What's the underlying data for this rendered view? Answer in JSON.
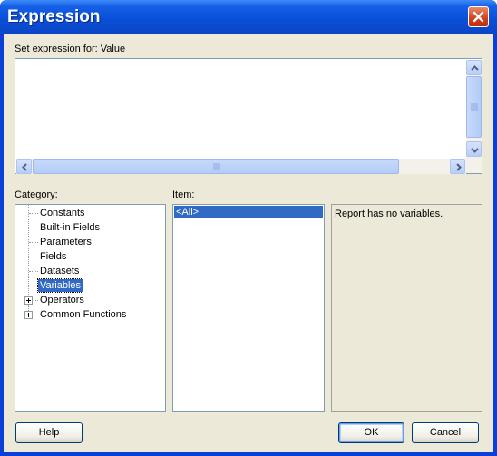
{
  "window": {
    "title": "Expression"
  },
  "expression": {
    "label": "Set expression for: Value",
    "value": ""
  },
  "category": {
    "label": "Category:",
    "items": [
      {
        "label": "Constants",
        "expandable": false,
        "selected": false
      },
      {
        "label": "Built-in Fields",
        "expandable": false,
        "selected": false
      },
      {
        "label": "Parameters",
        "expandable": false,
        "selected": false
      },
      {
        "label": "Fields",
        "expandable": false,
        "selected": false
      },
      {
        "label": "Datasets",
        "expandable": false,
        "selected": false
      },
      {
        "label": "Variables",
        "expandable": false,
        "selected": true
      },
      {
        "label": "Operators",
        "expandable": true,
        "selected": false
      },
      {
        "label": "Common Functions",
        "expandable": true,
        "selected": false
      }
    ]
  },
  "item": {
    "label": "Item:",
    "items": [
      "<All>"
    ]
  },
  "description": {
    "text": "Report has no variables."
  },
  "buttons": {
    "help": "Help",
    "ok": "OK",
    "cancel": "Cancel"
  },
  "icons": {
    "close": "close-icon",
    "scroll_up": "chevron-up-icon",
    "scroll_down": "chevron-down-icon",
    "scroll_left": "chevron-left-icon",
    "scroll_right": "chevron-right-icon",
    "expand": "plus-icon"
  },
  "colors": {
    "titlebar": "#0a4fd8",
    "selection": "#316ac5",
    "dialog_bg": "#ece9d8",
    "close_button": "#d0401c"
  }
}
